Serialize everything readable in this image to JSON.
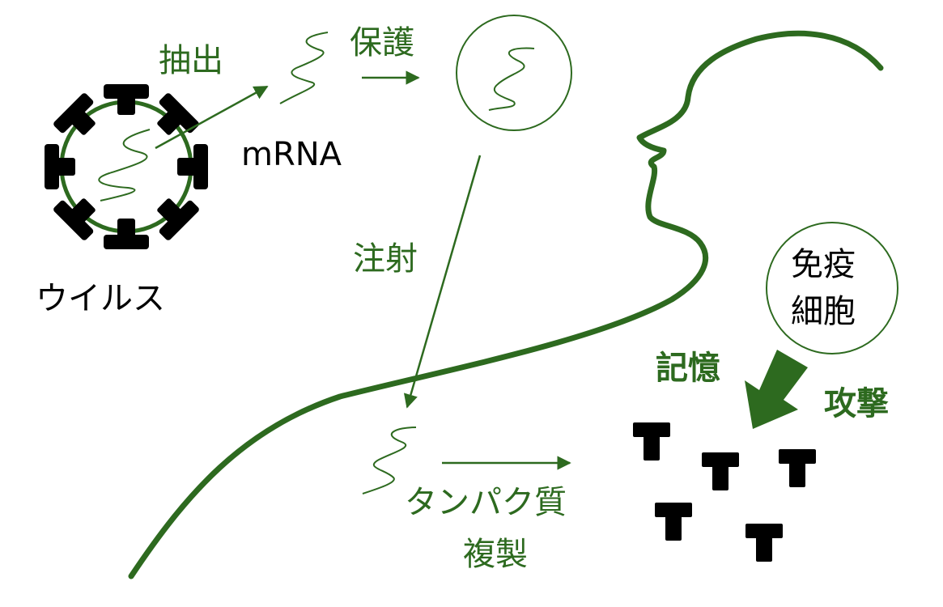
{
  "labels": {
    "extract": "抽出",
    "mrna": "mRNA",
    "virus": "ウイルス",
    "protect": "保護",
    "inject": "注射",
    "protein": "タンパク質",
    "replicate": "複製",
    "immune_line1": "免疫",
    "immune_line2": "細胞",
    "memory": "記憶",
    "attack": "攻撃"
  },
  "colors": {
    "accent": "#2d6a1f",
    "ink": "#000000"
  },
  "icons": [
    "virus-icon",
    "spike-protein-icon",
    "mrna-strand-icon",
    "protective-capsule-icon",
    "human-profile-icon",
    "arrow-icon"
  ]
}
